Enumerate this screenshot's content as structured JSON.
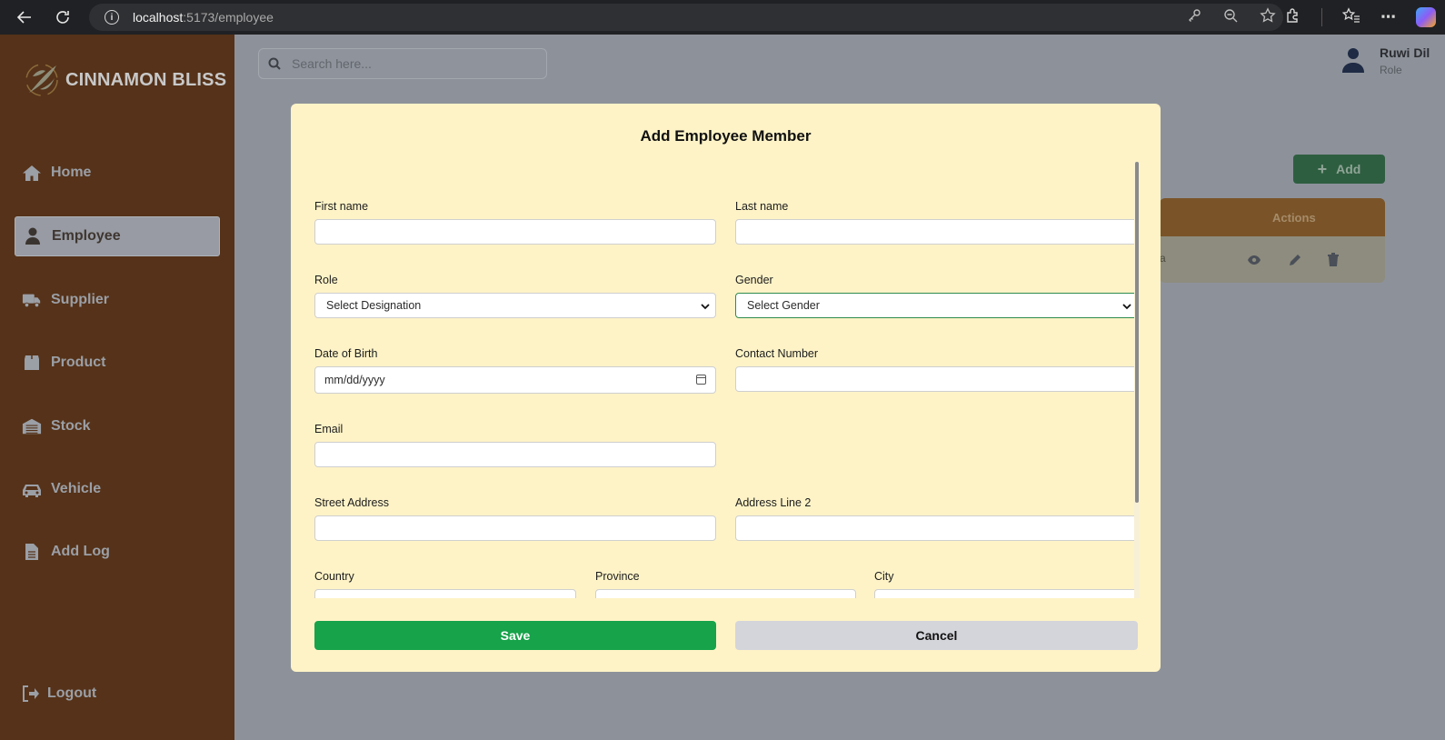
{
  "browser": {
    "url_host": "localhost",
    "url_path": ":5173/employee"
  },
  "sidebar": {
    "brand": "CINNAMON BLISS",
    "items": [
      {
        "label": "Home",
        "icon": "home-icon"
      },
      {
        "label": "Employee",
        "icon": "user-icon",
        "active": true
      },
      {
        "label": "Supplier",
        "icon": "truck-icon"
      },
      {
        "label": "Product",
        "icon": "box-icon"
      },
      {
        "label": "Stock",
        "icon": "warehouse-icon"
      },
      {
        "label": "Vehicle",
        "icon": "car-icon"
      },
      {
        "label": "Add Log",
        "icon": "document-icon"
      }
    ],
    "logout": "Logout"
  },
  "header": {
    "search_placeholder": "Search here...",
    "user_name": "Ruwi Dil",
    "user_role": "Role"
  },
  "page": {
    "add_label": "Add",
    "table_actions_header": "Actions",
    "row_partial_text": "a"
  },
  "modal": {
    "title": "Add Employee Member",
    "fields": {
      "first_name": {
        "label": "First name",
        "value": ""
      },
      "last_name": {
        "label": "Last name",
        "value": ""
      },
      "role": {
        "label": "Role",
        "value": "Select Designation"
      },
      "gender": {
        "label": "Gender",
        "value": "Select Gender"
      },
      "dob": {
        "label": "Date of Birth",
        "value": "mm/dd/yyyy"
      },
      "contact": {
        "label": "Contact Number",
        "value": ""
      },
      "email": {
        "label": "Email",
        "value": ""
      },
      "street": {
        "label": "Street Address",
        "value": ""
      },
      "address2": {
        "label": "Address Line 2",
        "value": ""
      },
      "country": {
        "label": "Country",
        "value": ""
      },
      "province": {
        "label": "Province",
        "value": ""
      },
      "city": {
        "label": "City",
        "value": ""
      }
    },
    "save_label": "Save",
    "cancel_label": "Cancel"
  },
  "colors": {
    "sidebar_bg": "#553219",
    "modal_bg": "#fef3c7",
    "save_green": "#16a34a",
    "cancel_gray": "#d4d5db",
    "focus_green": "#2e8b4e"
  }
}
